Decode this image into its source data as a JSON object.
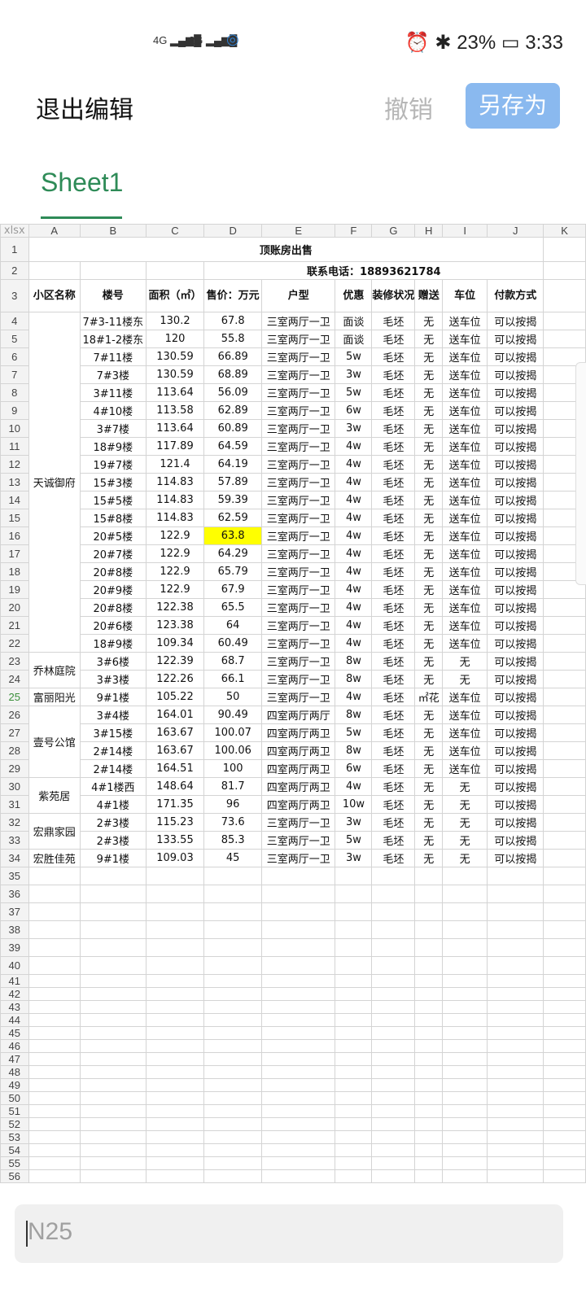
{
  "status": {
    "signal1": "4G",
    "signal2": "2G",
    "battery": "23%",
    "time": "3:33"
  },
  "header": {
    "exit_label": "退出编辑",
    "undo_label": "撤销",
    "saveas_label": "另存为"
  },
  "sheet_tab": "Sheet1",
  "corner_label": "xlsx",
  "columns": [
    "A",
    "B",
    "C",
    "D",
    "E",
    "F",
    "G",
    "H",
    "I",
    "J",
    "K"
  ],
  "title": "顶账房出售",
  "phone": "联系电话：18893621784",
  "headers": [
    "小区名称",
    "楼号",
    "面积（㎡）",
    "售价：万元",
    "户型",
    "优惠",
    "装修状况",
    "赠送",
    "车位",
    "付款方式"
  ],
  "groups": [
    {
      "name": "天诚御府",
      "rows": [
        [
          "7#3-11楼东",
          "130.2",
          "67.8",
          "三室两厅一卫",
          "面谈",
          "毛坯",
          "无",
          "送车位",
          "可以按揭"
        ],
        [
          "18#1-2楼东",
          "120",
          "55.8",
          "三室两厅一卫",
          "面谈",
          "毛坯",
          "无",
          "送车位",
          "可以按揭"
        ],
        [
          "7#11楼",
          "130.59",
          "66.89",
          "三室两厅一卫",
          "5w",
          "毛坯",
          "无",
          "送车位",
          "可以按揭"
        ],
        [
          "7#3楼",
          "130.59",
          "68.89",
          "三室两厅一卫",
          "3w",
          "毛坯",
          "无",
          "送车位",
          "可以按揭"
        ],
        [
          "3#11楼",
          "113.64",
          "56.09",
          "三室两厅一卫",
          "5w",
          "毛坯",
          "无",
          "送车位",
          "可以按揭"
        ],
        [
          "4#10楼",
          "113.58",
          "62.89",
          "三室两厅一卫",
          "6w",
          "毛坯",
          "无",
          "送车位",
          "可以按揭"
        ],
        [
          "3#7楼",
          "113.64",
          "60.89",
          "三室两厅一卫",
          "3w",
          "毛坯",
          "无",
          "送车位",
          "可以按揭"
        ],
        [
          "18#9楼",
          "117.89",
          "64.59",
          "三室两厅一卫",
          "4w",
          "毛坯",
          "无",
          "送车位",
          "可以按揭"
        ],
        [
          "19#7楼",
          "121.4",
          "64.19",
          "三室两厅一卫",
          "4w",
          "毛坯",
          "无",
          "送车位",
          "可以按揭"
        ],
        [
          "15#3楼",
          "114.83",
          "57.89",
          "三室两厅一卫",
          "4w",
          "毛坯",
          "无",
          "送车位",
          "可以按揭"
        ],
        [
          "15#5楼",
          "114.83",
          "59.39",
          "三室两厅一卫",
          "4w",
          "毛坯",
          "无",
          "送车位",
          "可以按揭"
        ],
        [
          "15#8楼",
          "114.83",
          "62.59",
          "三室两厅一卫",
          "4w",
          "毛坯",
          "无",
          "送车位",
          "可以按揭"
        ],
        [
          "20#5楼",
          "122.9",
          "63.8",
          "三室两厅一卫",
          "4w",
          "毛坯",
          "无",
          "送车位",
          "可以按揭"
        ],
        [
          "20#7楼",
          "122.9",
          "64.29",
          "三室两厅一卫",
          "4w",
          "毛坯",
          "无",
          "送车位",
          "可以按揭"
        ],
        [
          "20#8楼",
          "122.9",
          "65.79",
          "三室两厅一卫",
          "4w",
          "毛坯",
          "无",
          "送车位",
          "可以按揭"
        ],
        [
          "20#9楼",
          "122.9",
          "67.9",
          "三室两厅一卫",
          "4w",
          "毛坯",
          "无",
          "送车位",
          "可以按揭"
        ],
        [
          "20#8楼",
          "122.38",
          "65.5",
          "三室两厅一卫",
          "4w",
          "毛坯",
          "无",
          "送车位",
          "可以按揭"
        ],
        [
          "20#6楼",
          "123.38",
          "64",
          "三室两厅一卫",
          "4w",
          "毛坯",
          "无",
          "送车位",
          "可以按揭"
        ],
        [
          "18#9楼",
          "109.34",
          "60.49",
          "三室两厅一卫",
          "4w",
          "毛坯",
          "无",
          "送车位",
          "可以按揭"
        ]
      ]
    },
    {
      "name": "乔林庭院",
      "rows": [
        [
          "3#6楼",
          "122.39",
          "68.7",
          "三室两厅一卫",
          "8w",
          "毛坯",
          "无",
          "无",
          "可以按揭"
        ],
        [
          "3#3楼",
          "122.26",
          "66.1",
          "三室两厅一卫",
          "8w",
          "毛坯",
          "无",
          "无",
          "可以按揭"
        ]
      ]
    },
    {
      "name": "富丽阳光",
      "rows": [
        [
          "9#1楼",
          "105.22",
          "50",
          "三室两厅一卫",
          "4w",
          "毛坯",
          "㎡花",
          "送车位",
          "可以按揭"
        ]
      ]
    },
    {
      "name": "壹号公馆",
      "rows": [
        [
          "3#4楼",
          "164.01",
          "90.49",
          "四室两厅两厅",
          "8w",
          "毛坯",
          "无",
          "送车位",
          "可以按揭"
        ],
        [
          "3#15楼",
          "163.67",
          "100.07",
          "四室两厅两卫",
          "5w",
          "毛坯",
          "无",
          "送车位",
          "可以按揭"
        ],
        [
          "2#14楼",
          "163.67",
          "100.06",
          "四室两厅两卫",
          "8w",
          "毛坯",
          "无",
          "送车位",
          "可以按揭"
        ],
        [
          "2#14楼",
          "164.51",
          "100",
          "四室两厅两卫",
          "6w",
          "毛坯",
          "无",
          "送车位",
          "可以按揭"
        ]
      ]
    },
    {
      "name": "紫苑居",
      "rows": [
        [
          "4#1楼西",
          "148.64",
          "81.7",
          "四室两厅两卫",
          "4w",
          "毛坯",
          "无",
          "无",
          "可以按揭"
        ],
        [
          "4#1楼",
          "171.35",
          "96",
          "四室两厅两卫",
          "10w",
          "毛坯",
          "无",
          "无",
          "可以按揭"
        ]
      ]
    },
    {
      "name": "宏鼎家园",
      "rows": [
        [
          "2#3楼",
          "115.23",
          "73.6",
          "三室两厅一卫",
          "3w",
          "毛坯",
          "无",
          "无",
          "可以按揭"
        ],
        [
          "2#3楼",
          "133.55",
          "85.3",
          "三室两厅一卫",
          "5w",
          "毛坯",
          "无",
          "无",
          "可以按揭"
        ]
      ]
    },
    {
      "name": "宏胜佳苑",
      "rows": [
        [
          "9#1楼",
          "109.03",
          "45",
          "三室两厅一卫",
          "3w",
          "毛坯",
          "无",
          "无",
          "可以按揭"
        ]
      ]
    }
  ],
  "highlight_cell": "D16",
  "selected_row": 25,
  "blank_rows_from": 35,
  "blank_rows_to": 56,
  "formula_bar": {
    "cell_ref": "N25"
  },
  "colors": {
    "accent_green": "#2e8b57",
    "saveas_blue": "#8ab9ef",
    "highlight": "#ffff00"
  }
}
